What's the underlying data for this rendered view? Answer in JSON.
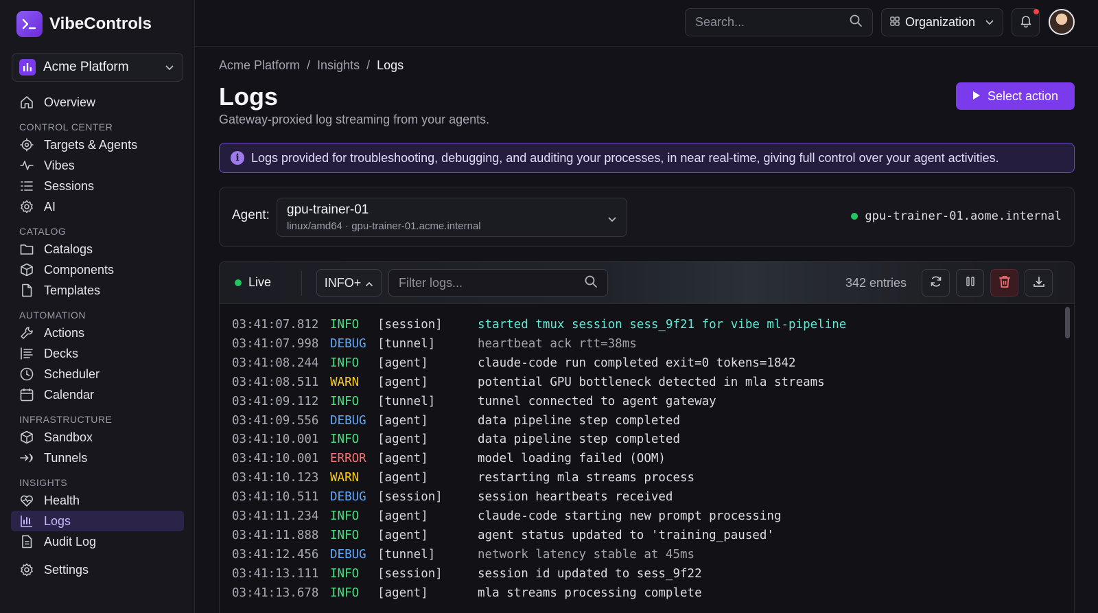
{
  "brand": {
    "name": "VibeControls"
  },
  "project": {
    "name": "Acme Platform"
  },
  "sidebar": {
    "overview": "Overview",
    "sections": [
      {
        "title": "CONTROL CENTER",
        "items": [
          {
            "label": "Targets & Agents",
            "icon": "target-icon"
          },
          {
            "label": "Vibes",
            "icon": "activity-icon"
          },
          {
            "label": "Sessions",
            "icon": "list-icon"
          },
          {
            "label": "AI",
            "icon": "gear-icon"
          }
        ]
      },
      {
        "title": "CATALOG",
        "items": [
          {
            "label": "Catalogs",
            "icon": "folder-icon"
          },
          {
            "label": "Components",
            "icon": "cube-icon"
          },
          {
            "label": "Templates",
            "icon": "file-icon"
          }
        ]
      },
      {
        "title": "AUTOMATION",
        "items": [
          {
            "label": "Actions",
            "icon": "wrench-icon"
          },
          {
            "label": "Decks",
            "icon": "lines-icon"
          },
          {
            "label": "Scheduler",
            "icon": "clock-icon"
          },
          {
            "label": "Calendar",
            "icon": "calendar-icon"
          }
        ]
      },
      {
        "title": "INFRASTRUCTURE",
        "items": [
          {
            "label": "Sandbox",
            "icon": "cube-icon"
          },
          {
            "label": "Tunnels",
            "icon": "tunnel-icon"
          }
        ]
      },
      {
        "title": "INSIGHTS",
        "items": [
          {
            "label": "Health",
            "icon": "heart-pulse-icon"
          },
          {
            "label": "Logs",
            "icon": "bar-chart-icon",
            "active": true
          },
          {
            "label": "Audit Log",
            "icon": "document-icon"
          }
        ]
      }
    ],
    "settings": "Settings"
  },
  "topbar": {
    "search_placeholder": "Search...",
    "org_label": "Organization"
  },
  "breadcrumb": [
    "Acme Platform",
    "Insights",
    "Logs"
  ],
  "page": {
    "title": "Logs",
    "subtitle": "Gateway-proxied log streaming from your agents.",
    "primary_action": "Select action",
    "banner": "Logs provided for troubleshooting, debugging, and auditing your processes, in near real-time, giving full control over your agent activities."
  },
  "agent": {
    "label": "Agent:",
    "name": "gpu-trainer-01",
    "meta": "linux/amd64 · gpu-trainer-01.acme.internal",
    "host": "gpu-trainer-01.aome.internal"
  },
  "logs": {
    "live_label": "Live",
    "level_filter": "INFO+",
    "filter_placeholder": "Filter logs...",
    "entries_label": "342 entries",
    "colors": {
      "INFO": "#4ade80",
      "DEBUG": "#60a5fa",
      "WARN": "#facc15",
      "ERROR": "#f87171"
    },
    "rows": [
      {
        "ts": "03:41:07.812",
        "level": "INFO",
        "src": "[session]",
        "msg": "started tmux session sess_9f21 for vibe ml-pipeline"
      },
      {
        "ts": "03:41:07.998",
        "level": "DEBUG",
        "src": "[tunnel]",
        "msg": "heartbeat ack rtt=38ms"
      },
      {
        "ts": "03:41:08.244",
        "level": "INFO",
        "src": "[agent]",
        "msg": "claude-code run completed exit=0 tokens=1842"
      },
      {
        "ts": "03:41:08.511",
        "level": "WARN",
        "src": "[agent]",
        "msg": "potential GPU bottleneck detected in mla streams"
      },
      {
        "ts": "03:41:09.112",
        "level": "INFO",
        "src": "[tunnel]",
        "msg": "tunnel connected to agent gateway"
      },
      {
        "ts": "03:41:09.556",
        "level": "DEBUG",
        "src": "[agent]",
        "msg": "data pipeline step completed"
      },
      {
        "ts": "03:41:10.001",
        "level": "INFO",
        "src": "[agent]",
        "msg": "data pipeline step completed"
      },
      {
        "ts": "03:41:10.001",
        "level": "ERROR",
        "src": "[agent]",
        "msg": "model loading failed (OOM)"
      },
      {
        "ts": "03:41:10.123",
        "level": "WARN",
        "src": "[agent]",
        "msg": "restarting mla streams process"
      },
      {
        "ts": "03:41:10.511",
        "level": "DEBUG",
        "src": "[session]",
        "msg": "session heartbeats received"
      },
      {
        "ts": "03:41:11.234",
        "level": "INFO",
        "src": "[agent]",
        "msg": "claude-code starting new prompt processing"
      },
      {
        "ts": "03:41:11.888",
        "level": "INFO",
        "src": "[agent]",
        "msg": "agent status updated to 'training_paused'"
      },
      {
        "ts": "03:41:12.456",
        "level": "DEBUG",
        "src": "[tunnel]",
        "msg": "network latency stable at 45ms"
      },
      {
        "ts": "03:41:13.111",
        "level": "INFO",
        "src": "[session]",
        "msg": "session id updated to sess_9f22"
      },
      {
        "ts": "03:41:13.678",
        "level": "INFO",
        "src": "[agent]",
        "msg": "mla streams processing complete"
      }
    ]
  }
}
